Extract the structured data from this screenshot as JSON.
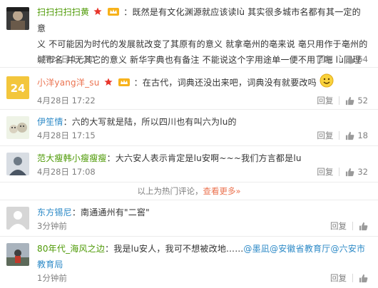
{
  "comments": [
    {
      "user": "扫扫扫扫扫黄",
      "line1": "既然是有文化渊源就应该读lù 其实很多城市名都有其一定的意",
      "line2": "义 不可能因为时代的发展就改变了其原有的意义 就拿亳州的亳来说 亳只用作于亳州的",
      "line3": "城市名 并无其它的意义 新华字典也有备注 不能说这个字用途单一便不用了吧 lù同理",
      "time": "4月28日 17:30",
      "reply": "回复",
      "likes": "64"
    },
    {
      "user": "小洋yang洋_su",
      "text": "在古代，词典还没出来吧，词典没有就要改吗",
      "time": "4月28日 17:22",
      "reply": "回复",
      "likes": "52"
    },
    {
      "user": "伊笙情",
      "text": "六的大写就是陆，所以四川也有叫六为lu的",
      "time": "4月28日 17:15",
      "reply": "回复",
      "likes": "18"
    },
    {
      "user": "范大瘦韩小瘦瘦瘦",
      "text": "大六安人表示肯定是lu安啊~~~我们方言都是lu",
      "time": "4月28日 17:08",
      "reply": "回复",
      "likes": "32"
    },
    {
      "user": "东方锡尼",
      "text": "南通通州有\"二窖\"",
      "time": "3分钟前",
      "reply": "回复"
    },
    {
      "user": "80年代_海风之边",
      "text_a": "我是lu安人，我可不想被改地……",
      "mention1": "@墨凪",
      "mention2": "@安徽省教育厅",
      "mention3": "@六安市",
      "line2": "教育局",
      "time": "1分钟前",
      "reply": "回复"
    }
  ],
  "hot_bar": {
    "text": "以上为热门评论，",
    "link": "查看更多»"
  },
  "colors": {
    "username": "#eb7350",
    "link": "#2d8ac7",
    "meta": "#808080"
  }
}
